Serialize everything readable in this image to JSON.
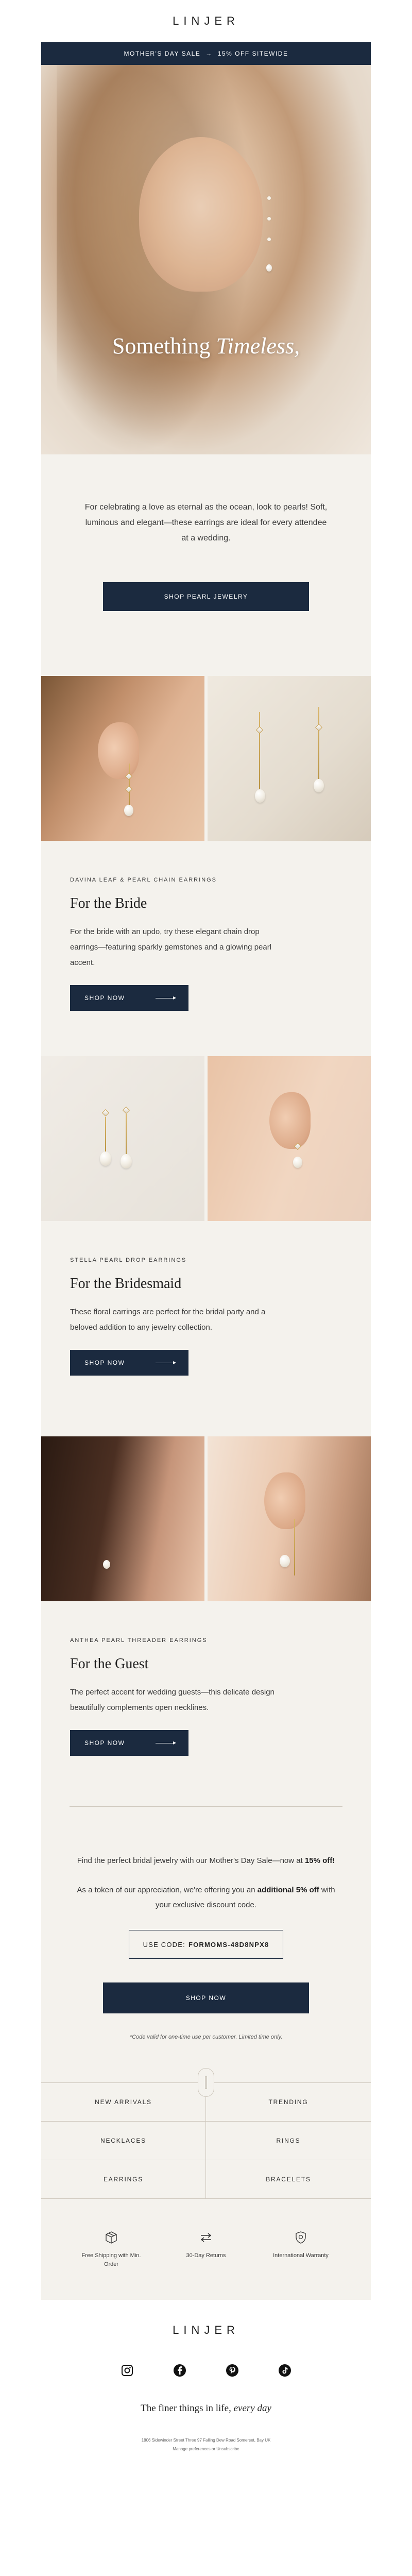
{
  "brand": {
    "logo": "LINJER"
  },
  "promo": {
    "sale_name": "MOTHER'S DAY SALE",
    "arrow": "→",
    "offer": "15% OFF SITEWIDE"
  },
  "hero": {
    "title_plain": "Something",
    "title_italic": "Timeless,"
  },
  "intro": {
    "text": "For celebrating a love as eternal as the ocean, look to pearls! Soft, luminous and elegant—these earrings are ideal for every attendee at a wedding.",
    "button": "SHOP PEARL JEWELRY"
  },
  "products": [
    {
      "eyebrow": "DAVINA LEAF & PEARL CHAIN EARRINGS",
      "title": "For the Bride",
      "description": "For the bride with an updo, try these elegant chain drop earrings—featuring sparkly gemstones and a glowing pearl accent.",
      "button": "SHOP NOW"
    },
    {
      "eyebrow": "STELLA PEARL DROP EARRINGS",
      "title": "For the Bridesmaid",
      "description": "These floral earrings are perfect for the bridal party and a beloved addition to any jewelry collection.",
      "button": "SHOP NOW"
    },
    {
      "eyebrow": "ANTHEA PEARL THREADER EARRINGS",
      "title": "For the Guest",
      "description": "The perfect accent for wedding guests—this delicate design beautifully complements open necklines.",
      "button": "SHOP NOW"
    }
  ],
  "discount": {
    "line1_a": "Find the perfect bridal jewelry with our Mother's Day Sale—now at ",
    "line1_b": "15% off!",
    "line2_a": "As a token of our appreciation, we're offering you an ",
    "line2_b": "additional 5% off",
    "line2_c": " with your exclusive discount code.",
    "code_label": "USE CODE:",
    "code": "FORMOMS-48D8NPX8",
    "button": "SHOP NOW",
    "note": "*Code valid for one-time use per customer. Limited time only."
  },
  "nav": [
    "NEW ARRIVALS",
    "TRENDING",
    "NECKLACES",
    "RINGS",
    "EARRINGS",
    "BRACELETS"
  ],
  "perks": [
    {
      "icon": "box-icon",
      "label": "Free Shipping with Min. Order"
    },
    {
      "icon": "exchange-arrows-icon",
      "label": "30-Day Returns"
    },
    {
      "icon": "shield-icon",
      "label": "International Warranty"
    }
  ],
  "footer": {
    "logo": "LINJER",
    "socials": [
      "instagram-icon",
      "facebook-icon",
      "pinterest-icon",
      "tiktok-icon"
    ],
    "tagline_plain": "The finer things in life,",
    "tagline_italic": "every day",
    "address": "1806 Sidewinder Street Three 97 Falling Dew Road Somerset, Bay UK",
    "prefs": "Manage preferences or Unsubscribe"
  },
  "colors": {
    "navy": "#1b2a3f",
    "cream": "#f4f2ed",
    "text": "#3a3a3a"
  }
}
